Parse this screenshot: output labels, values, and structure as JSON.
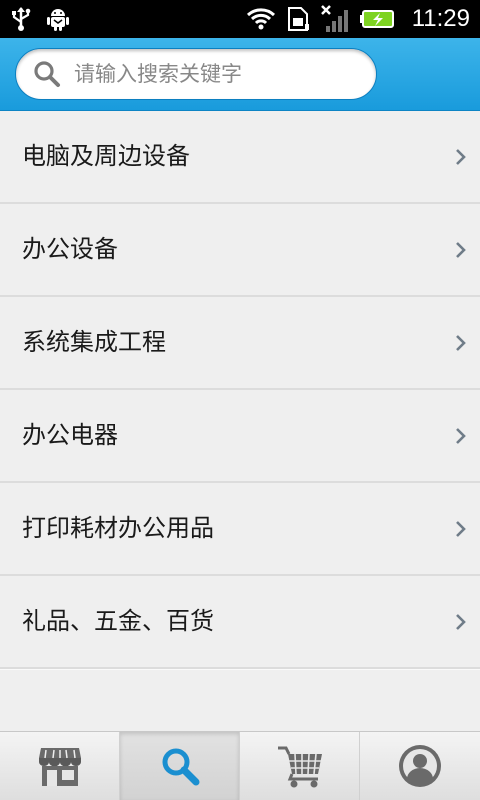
{
  "status_bar": {
    "time": "11:29",
    "icons": [
      "usb-icon",
      "android-debug-icon",
      "wifi-icon",
      "sim-icon",
      "no-signal-icon",
      "battery-charging-icon"
    ]
  },
  "search": {
    "placeholder": "请输入搜索关键字",
    "value": ""
  },
  "categories": [
    {
      "label": "电脑及周边设备"
    },
    {
      "label": "办公设备"
    },
    {
      "label": "系统集成工程"
    },
    {
      "label": "办公电器"
    },
    {
      "label": "打印耗材办公用品"
    },
    {
      "label": "礼品、五金、百货"
    }
  ],
  "tabbar": {
    "tabs": [
      {
        "icon": "store-icon",
        "active": false
      },
      {
        "icon": "search-icon",
        "active": true
      },
      {
        "icon": "cart-icon",
        "active": false
      },
      {
        "icon": "user-icon",
        "active": false
      }
    ]
  },
  "colors": {
    "header_blue": "#199bdc",
    "accent_blue": "#1b8fd0",
    "icon_gray": "#6a6a6a",
    "chevron_gray": "#6f7c88"
  }
}
